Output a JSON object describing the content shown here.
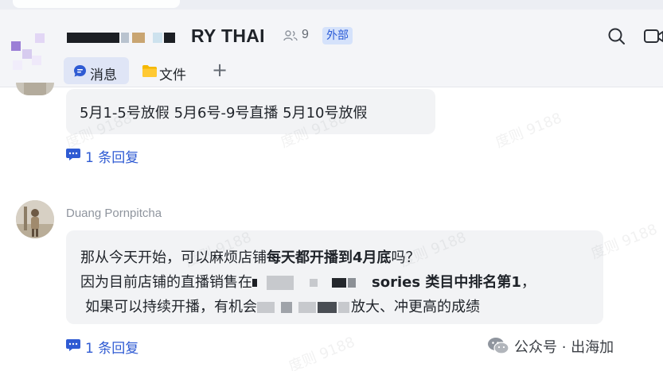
{
  "header": {
    "group_name": "RY THAI",
    "member_count": "9",
    "external_badge": "外部",
    "tabs": [
      {
        "label": "消息",
        "icon": "chat-bubble-icon",
        "active": true
      },
      {
        "label": "文件",
        "icon": "folder-icon",
        "active": false
      }
    ],
    "add_tab_label": "+"
  },
  "messages": [
    {
      "sender": "",
      "lines": [
        "5月1-5号放假  5月6号-9号直播   5月10号放假"
      ],
      "reply_label": "1 条回复"
    },
    {
      "sender": "Duang Pornpitcha",
      "line1_pre": "那从今天开始，可以麻烦店铺",
      "line1_bold": "每天都开播到4月底",
      "line1_post": "吗？",
      "line2_pre": "因为目前店铺的直播销售在",
      "line2_bold": "sories 类目中排名第1",
      "line2_post": "，",
      "line3_pre": "如果可以持续开播，有机会",
      "line3_post": "放大、冲更高的成绩",
      "reply_label": "1 条回复"
    }
  ],
  "watermark_text": "度则 9188",
  "source_mark": "公众号 · 出海加",
  "colors": {
    "accent": "#2f5bd3",
    "bubble": "#f2f3f5",
    "badge_bg": "#d5e2fb",
    "header_bg": "#f4f5f8"
  }
}
